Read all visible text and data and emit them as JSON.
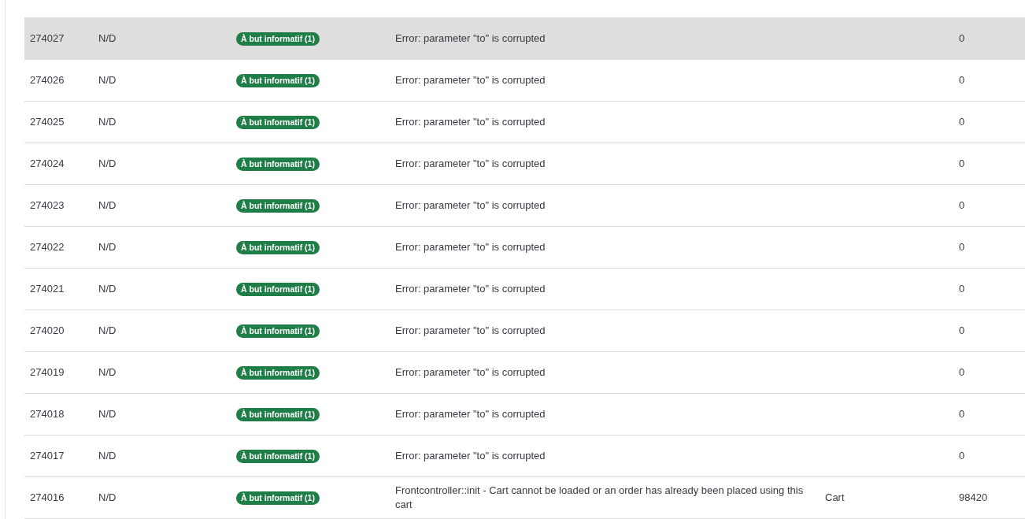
{
  "rows": [
    {
      "id": "274027",
      "employee": "N/D",
      "severity": "À but informatif (1)",
      "message": "Error: parameter \"to\" is corrupted",
      "object_id": "0",
      "highlighted": true
    },
    {
      "id": "274026",
      "employee": "N/D",
      "severity": "À but informatif (1)",
      "message": "Error: parameter \"to\" is corrupted",
      "object_id": "0",
      "highlighted": false
    },
    {
      "id": "274025",
      "employee": "N/D",
      "severity": "À but informatif (1)",
      "message": "Error: parameter \"to\" is corrupted",
      "object_id": "0",
      "highlighted": false
    },
    {
      "id": "274024",
      "employee": "N/D",
      "severity": "À but informatif (1)",
      "message": "Error: parameter \"to\" is corrupted",
      "object_id": "0",
      "highlighted": false
    },
    {
      "id": "274023",
      "employee": "N/D",
      "severity": "À but informatif (1)",
      "message": "Error: parameter \"to\" is corrupted",
      "object_id": "0",
      "highlighted": false
    },
    {
      "id": "274022",
      "employee": "N/D",
      "severity": "À but informatif (1)",
      "message": "Error: parameter \"to\" is corrupted",
      "object_id": "0",
      "highlighted": false
    },
    {
      "id": "274021",
      "employee": "N/D",
      "severity": "À but informatif (1)",
      "message": "Error: parameter \"to\" is corrupted",
      "object_id": "0",
      "highlighted": false
    },
    {
      "id": "274020",
      "employee": "N/D",
      "severity": "À but informatif (1)",
      "message": "Error: parameter \"to\" is corrupted",
      "object_id": "0",
      "highlighted": false
    },
    {
      "id": "274019",
      "employee": "N/D",
      "severity": "À but informatif (1)",
      "message": "Error: parameter \"to\" is corrupted",
      "object_id": "0",
      "highlighted": false
    },
    {
      "id": "274018",
      "employee": "N/D",
      "severity": "À but informatif (1)",
      "message": "Error: parameter \"to\" is corrupted",
      "object_id": "0",
      "highlighted": false
    },
    {
      "id": "274017",
      "employee": "N/D",
      "severity": "À but informatif (1)",
      "message": "Error: parameter \"to\" is corrupted",
      "object_id": "0",
      "highlighted": false
    },
    {
      "id": "274016",
      "employee": "N/D",
      "severity": "À but informatif (1)",
      "message": "Frontcontroller::init - Cart cannot be loaded or an order has already been placed using this cart",
      "object_type": "Cart",
      "object_id": "98420",
      "highlighted": false
    }
  ]
}
